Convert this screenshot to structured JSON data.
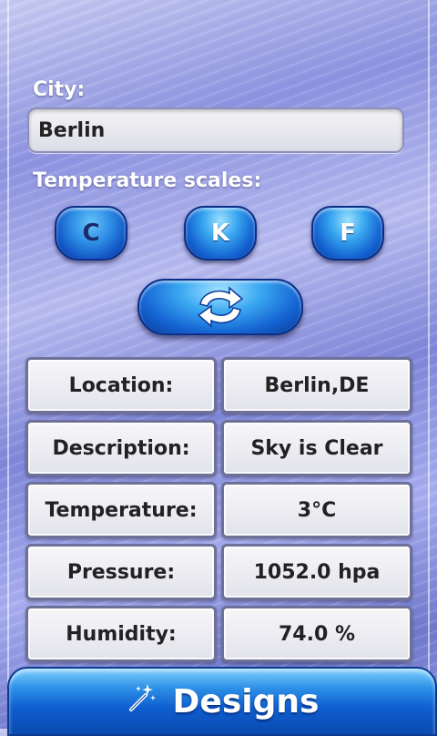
{
  "city": {
    "label": "City:",
    "value": "Berlin"
  },
  "scales": {
    "label": "Temperature scales:",
    "buttons": [
      "C",
      "K",
      "F"
    ],
    "selected": "C"
  },
  "refresh": {
    "icon": "refresh-icon"
  },
  "info_table": {
    "rows": [
      {
        "label": "Location:",
        "value": "Berlin,DE"
      },
      {
        "label": "Description:",
        "value": "Sky is Clear"
      },
      {
        "label": "Temperature:",
        "value": "3°C"
      },
      {
        "label": "Pressure:",
        "value": "1052.0 hpa"
      },
      {
        "label": "Humidity:",
        "value": "74.0 %"
      }
    ]
  },
  "footer": {
    "designs_label": "Designs",
    "icon": "magic-wand-icon"
  }
}
